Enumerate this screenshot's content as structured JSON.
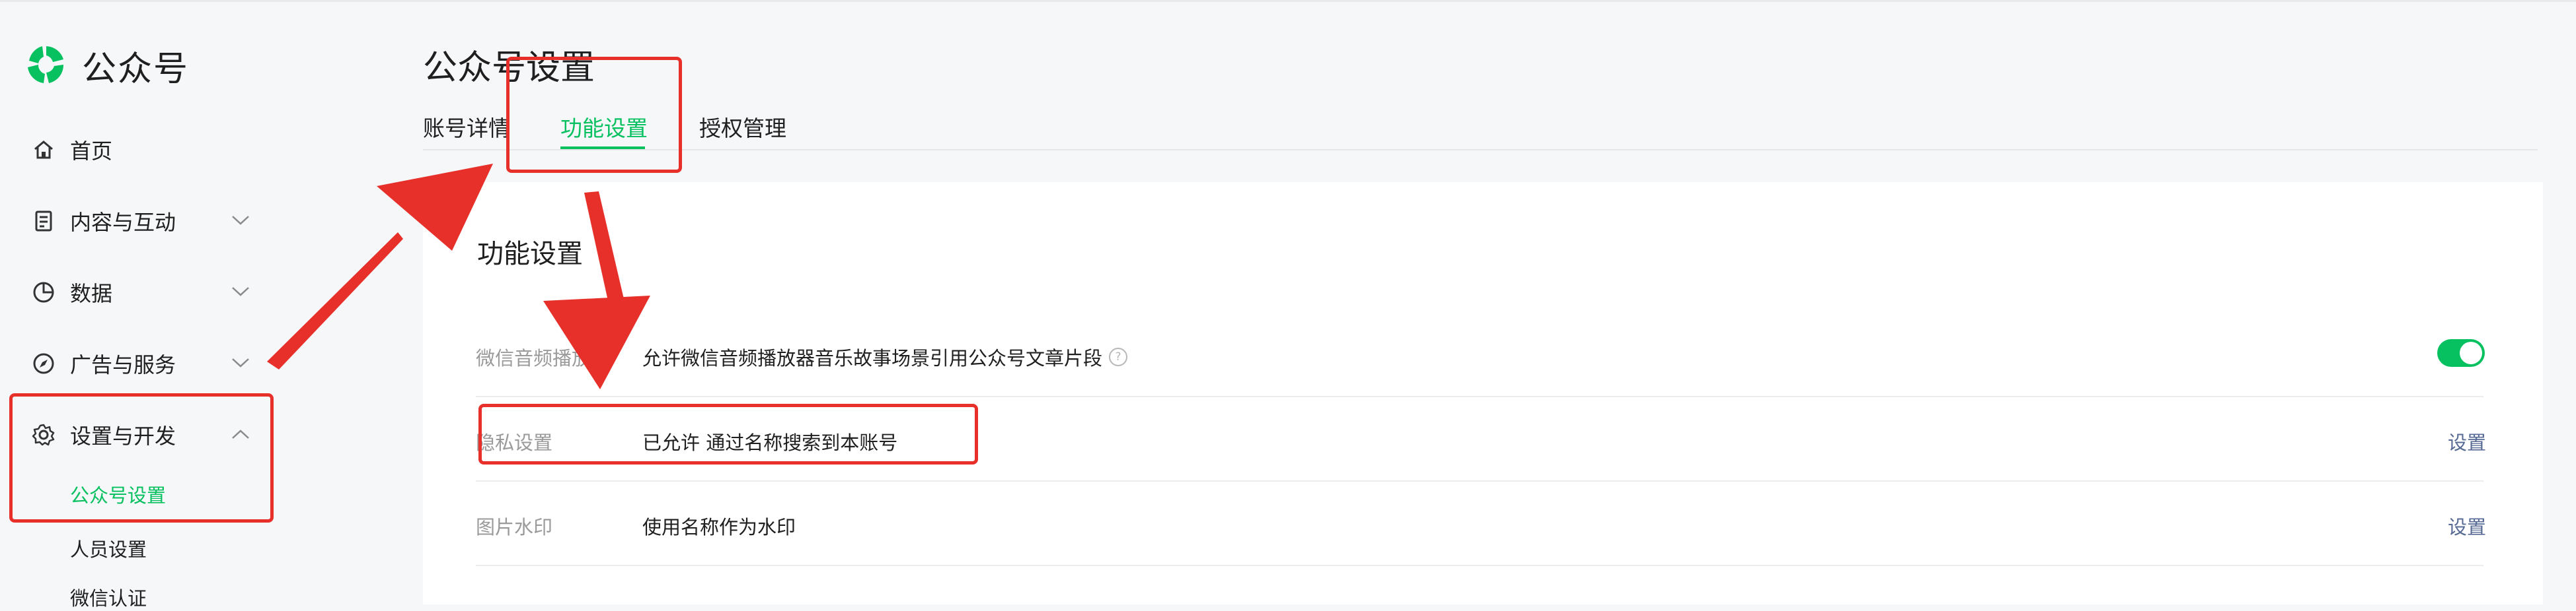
{
  "app": {
    "name": "公众号"
  },
  "sidebar": {
    "items": [
      {
        "label": "首页",
        "icon": "home-icon",
        "expandable": false
      },
      {
        "label": "内容与互动",
        "icon": "document-icon",
        "expandable": true
      },
      {
        "label": "数据",
        "icon": "pie-chart-icon",
        "expandable": true
      },
      {
        "label": "广告与服务",
        "icon": "compass-icon",
        "expandable": true
      },
      {
        "label": "设置与开发",
        "icon": "gear-icon",
        "expandable": true,
        "expanded": true
      }
    ],
    "sub_items": [
      {
        "label": "公众号设置",
        "active": true
      },
      {
        "label": "人员设置",
        "active": false
      },
      {
        "label": "微信认证",
        "active": false
      }
    ]
  },
  "main": {
    "title": "公众号设置",
    "tabs": [
      {
        "label": "账号详情",
        "active": false
      },
      {
        "label": "功能设置",
        "active": true
      },
      {
        "label": "授权管理",
        "active": false
      }
    ],
    "section_title": "功能设置",
    "rows": [
      {
        "label": "微信音频播放",
        "value": "允许微信音频播放器音乐故事场景引用公众号文章片段",
        "help_icon": "question-circle-icon",
        "control": "toggle",
        "toggle_on": true
      },
      {
        "label": "隐私设置",
        "value": "已允许 通过名称搜索到本账号",
        "action": "设置"
      },
      {
        "label": "图片水印",
        "value": "使用名称作为水印",
        "action": "设置"
      }
    ]
  },
  "colors": {
    "accent": "#07c160",
    "link": "#576b95",
    "annotation": "#e8302a"
  },
  "annotations": {
    "highlight_boxes": [
      "sidebar-settings-highlight",
      "tab-highlight",
      "privacy-row-highlight"
    ],
    "arrow_icons": [
      "annotation-arrow-to-tab",
      "annotation-arrow-to-privacy"
    ]
  }
}
